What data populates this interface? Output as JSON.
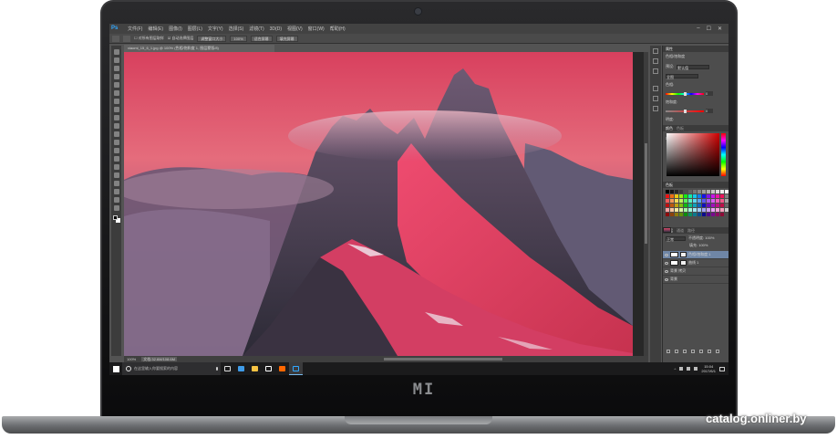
{
  "watermark": "catalog.onliner.by",
  "laptop": {
    "brand_logo": "MI"
  },
  "photoshop": {
    "app_icon": "Ps",
    "menu": [
      "文件(F)",
      "编辑(E)",
      "图像(I)",
      "图层(L)",
      "文字(Y)",
      "选择(S)",
      "滤镜(T)",
      "3D(D)",
      "视图(V)",
      "窗口(W)",
      "帮助(H)"
    ],
    "window_controls": [
      "–",
      "☐",
      "✕"
    ],
    "options_bar": {
      "items": [
        "☐ 对所有图层取样",
        "☑ 自动选择图层",
        "调整窗口大小",
        "100%",
        "适合屏幕",
        "填充屏幕"
      ]
    },
    "document_tab": "xiaomi_15_6_1.jpg @ 100% (色相/饱和度 1, 图层蒙版/8)",
    "status": {
      "zoom": "100%",
      "doc_info": "文档:32.6M/108.6M"
    },
    "properties": {
      "header": "属性",
      "title": "色相/饱和度",
      "preset_label": "预设:",
      "preset_value": "默认值",
      "channel_label": "全图",
      "sliders": [
        {
          "label": "色相:",
          "value": 0,
          "position": 0.5
        },
        {
          "label": "饱和度:",
          "value": 0,
          "position": 0.5
        },
        {
          "label": "明度:",
          "value": 0,
          "position": 0.5
        }
      ],
      "colorize_label": "着色"
    },
    "color_panel": {
      "header": "颜色",
      "tab2": "色板",
      "selected_color": "#d10000"
    },
    "swatches_panel": {
      "header": "色板"
    },
    "layers_panel": {
      "tabs": [
        "图层",
        "通道",
        "路径"
      ],
      "blend_mode": "正常",
      "opacity_label": "不透明度: 100%",
      "fill_label": "填充: 100%",
      "layers": [
        {
          "name": "色相/饱和度 1",
          "active": true
        },
        {
          "name": "曲线 1",
          "active": false
        },
        {
          "name": "背景 拷贝",
          "active": false
        },
        {
          "name": "背景",
          "active": false
        }
      ]
    }
  },
  "taskbar": {
    "search_placeholder": "在这里输入你要搜索的内容",
    "apps": [
      "task-view",
      "edge",
      "explorer",
      "store",
      "mi",
      "photoshop"
    ],
    "clock_time": "15:04",
    "clock_date": "2017/6/1",
    "colors": {
      "edge": "#3f9be8",
      "explorer": "#f6c343",
      "store": "#ffffff",
      "mi": "#ff6700",
      "photoshop": "#31a8ff"
    }
  }
}
